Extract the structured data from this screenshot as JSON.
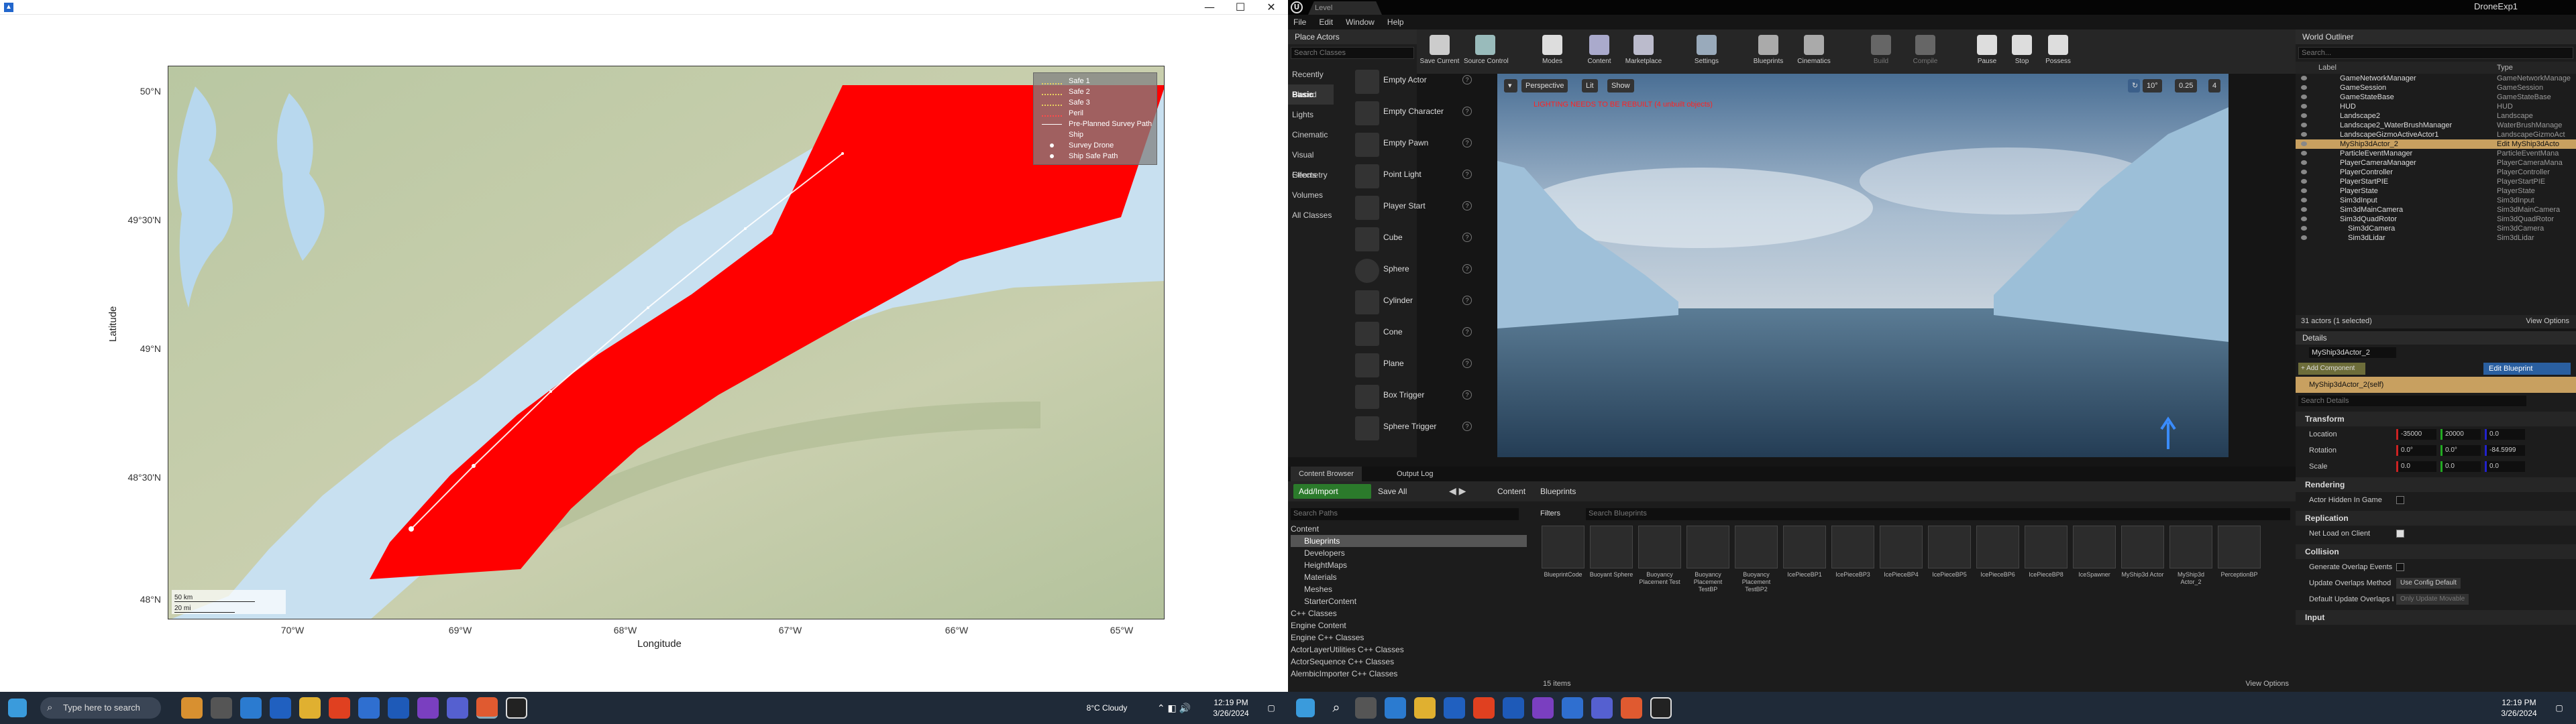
{
  "figure": {
    "window_controls": [
      "—",
      "☐",
      "✕"
    ],
    "y_ticks": [
      "50°N",
      "49°30'N",
      "49°N",
      "48°30'N",
      "48°N"
    ],
    "x_ticks": [
      "70°W",
      "69°W",
      "68°W",
      "67°W",
      "66°W",
      "65°W"
    ],
    "xlabel": "Longitude",
    "ylabel": "Latitude",
    "legend": [
      {
        "label": "Safe 1",
        "color": "#e8d060"
      },
      {
        "label": "Safe 2",
        "color": "#e8d060"
      },
      {
        "label": "Safe 3",
        "color": "#e8d060"
      },
      {
        "label": "Peril",
        "color": "#ff4a4a"
      },
      {
        "label": "Pre-Planned Survey Path",
        "color": "#ffffff"
      },
      {
        "label": "Ship",
        "color": "#cfcfcf"
      },
      {
        "label": "Survey Drone",
        "color": "#ffffff"
      },
      {
        "label": "Ship Safe Path",
        "color": "#ffffff"
      }
    ],
    "scale_labels": [
      "50 km",
      "20 mi"
    ]
  },
  "taskbar_left": {
    "search_placeholder": "Type here to search",
    "weather": "8°C  Cloudy",
    "time": "12:19 PM",
    "date": "3/26/2024"
  },
  "taskbar_right": {
    "time": "12:19 PM",
    "date": "3/26/2024"
  },
  "ue": {
    "tab": "Level",
    "project": "DroneExp1",
    "menu": [
      "File",
      "Edit",
      "Window",
      "Help"
    ],
    "place_actors": {
      "title": "Place Actors",
      "search_placeholder": "Search Classes",
      "categories": [
        "Recently Placed",
        "Basic",
        "Lights",
        "Cinematic",
        "Visual Effects",
        "Geometry",
        "Volumes",
        "All Classes"
      ],
      "items": [
        "Empty Actor",
        "Empty Character",
        "Empty Pawn",
        "Point Light",
        "Player Start",
        "Cube",
        "Sphere",
        "Cylinder",
        "Cone",
        "Plane",
        "Box Trigger",
        "Sphere Trigger"
      ]
    },
    "toolbar": [
      "Save Current",
      "Source Control",
      "Modes",
      "Content",
      "Marketplace",
      "Settings",
      "Blueprints",
      "Cinematics",
      "Build",
      "Compile",
      "Pause",
      "Stop",
      "Possess"
    ],
    "viewport": {
      "buttons": [
        "Perspective",
        "Lit",
        "Show"
      ],
      "warning": "LIGHTING NEEDS TO BE REBUILT (4 unbuilt objects)",
      "snap": [
        "10°",
        "0.25",
        "4"
      ]
    },
    "outliner": {
      "title": "World Outliner",
      "search_placeholder": "Search...",
      "col_label": "Label",
      "col_type": "Type",
      "rows": [
        {
          "name": "GameNetworkManager",
          "type": "GameNetworkManage"
        },
        {
          "name": "GameSession",
          "type": "GameSession"
        },
        {
          "name": "GameStateBase",
          "type": "GameStateBase"
        },
        {
          "name": "HUD",
          "type": "HUD"
        },
        {
          "name": "Landscape2",
          "type": "Landscape"
        },
        {
          "name": "Landscape2_WaterBrushManager",
          "type": "WaterBrushManage"
        },
        {
          "name": "LandscapeGizmoActiveActor1",
          "type": "LandscapeGizmoAct"
        },
        {
          "name": "MyShip3dActor_2",
          "type": "Edit MyShip3dActo"
        },
        {
          "name": "ParticleEventManager",
          "type": "ParticleEventMana"
        },
        {
          "name": "PlayerCameraManager",
          "type": "PlayerCameraMana"
        },
        {
          "name": "PlayerController",
          "type": "PlayerController"
        },
        {
          "name": "PlayerStartPIE",
          "type": "PlayerStartPIE"
        },
        {
          "name": "PlayerState",
          "type": "PlayerState"
        },
        {
          "name": "Sim3dInput",
          "type": "Sim3dInput"
        },
        {
          "name": "Sim3dMainCamera",
          "type": "Sim3dMainCamera"
        },
        {
          "name": "Sim3dQuadRotor",
          "type": "Sim3dQuadRotor"
        },
        {
          "name": "Sim3dCamera",
          "type": "Sim3dCamera"
        },
        {
          "name": "Sim3dLidar",
          "type": "Sim3dLidar"
        }
      ],
      "footer": "31 actors (1 selected)",
      "view_options": "View Options"
    },
    "details": {
      "title": "Details",
      "actor_name": "MyShip3dActor_2",
      "add_component": "+ Add Component",
      "edit_blueprint": "Edit Blueprint",
      "self_label": "MyShip3dActor_2(self)",
      "search_placeholder": "Search Details",
      "transform": "Transform",
      "location_label": "Location",
      "rotation_label": "Rotation",
      "scale_label": "Scale",
      "location": [
        "-35000",
        "20000",
        "0.0"
      ],
      "rotation": [
        "0.0°",
        "0.0°",
        "-84.5999"
      ],
      "scale": [
        "0.0",
        "0.0",
        "0.0"
      ],
      "rendering": "Rendering",
      "hidden_in_game": "Actor Hidden In Game",
      "replication": "Replication",
      "net_load": "Net Load on Client",
      "collision": "Collision",
      "overlap_events": "Generate Overlap Events",
      "update_overlaps": "Update Overlaps Method",
      "update_overlaps_val": "Use Config Default",
      "default_overlaps": "Default Update Overlaps I",
      "default_overlaps_val": "Only Update Movable",
      "input": "Input"
    },
    "content_browser": {
      "tab": "Content Browser",
      "output_tab": "Output Log",
      "add_import": "Add/Import",
      "save_all": "Save All",
      "path": [
        "Content",
        "Blueprints"
      ],
      "search_paths": "Search Paths",
      "filters": "Filters",
      "search_assets": "Search Blueprints",
      "tree": [
        "Content",
        "Blueprints",
        "Developers",
        "HeightMaps",
        "Materials",
        "Meshes",
        "StarterContent",
        "C++ Classes",
        "Engine Content",
        "Engine C++ Classes",
        "ActorLayerUtilities C++ Classes",
        "ActorSequence C++ Classes",
        "AlembicImporter C++ Classes"
      ],
      "assets": [
        "BlueprintCode",
        "Buoyant Sphere",
        "Buoyancy Placement Test",
        "Buoyancy Placement TestBP",
        "Buoyancy Placement TestBP2",
        "IcePieceBP1",
        "IcePieceBP3",
        "IcePieceBP4",
        "IcePieceBP5",
        "IcePieceBP6",
        "IcePieceBP8",
        "IceSpawner",
        "MyShip3d Actor",
        "MyShip3d Actor_2",
        "PerceptionBP"
      ],
      "item_count": "15 items",
      "view_options": "View Options"
    }
  }
}
